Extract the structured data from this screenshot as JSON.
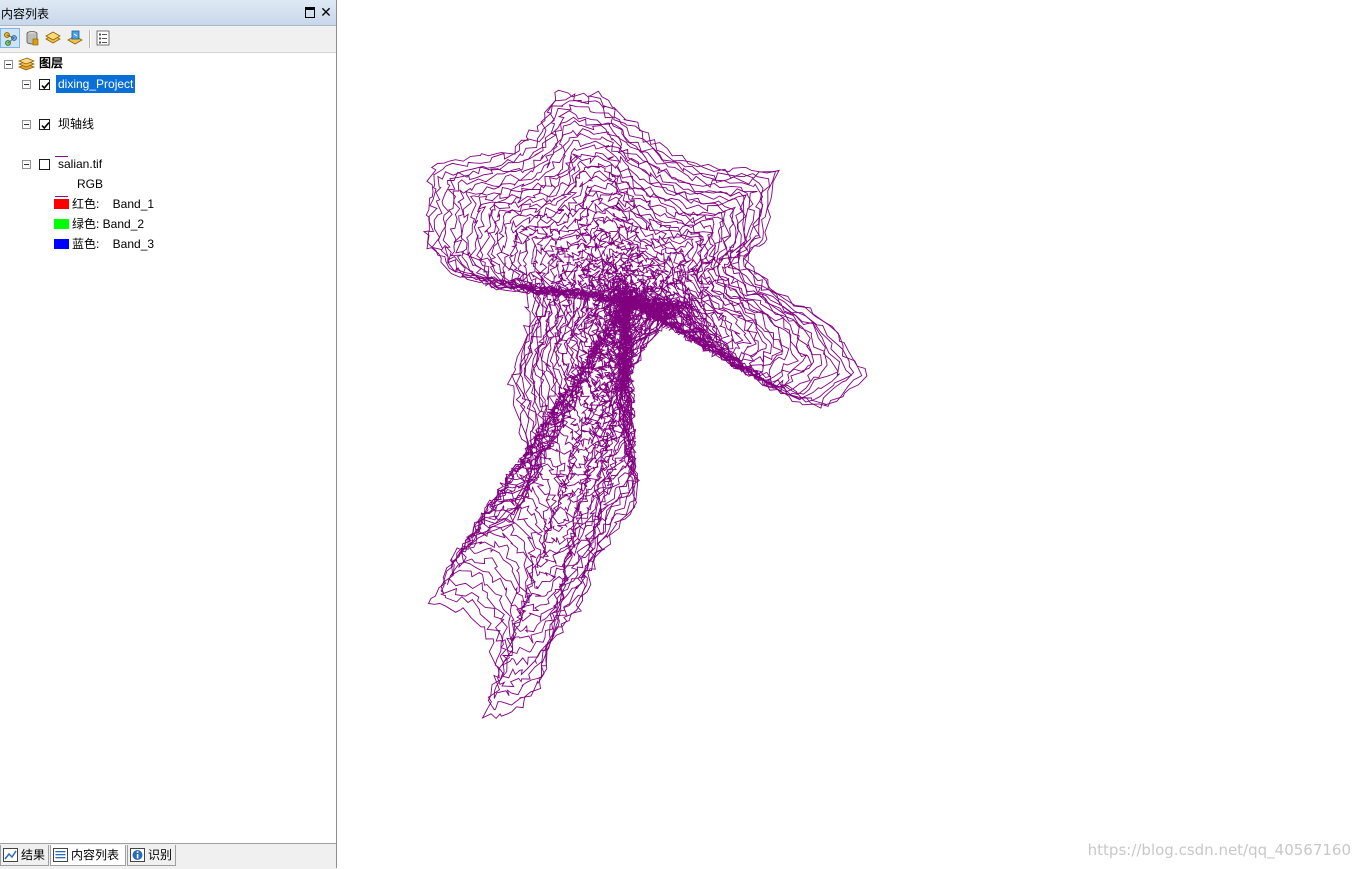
{
  "panel": {
    "title": "内容列表"
  },
  "tree": {
    "root_label": "图层",
    "layers": [
      {
        "label": "dixing_Project",
        "checked": true,
        "selected": true,
        "symbol": "line",
        "color": "#8b0a8b"
      },
      {
        "label": "坝轴线",
        "checked": true,
        "selected": false,
        "symbol": "line",
        "color": "#8b0a8b"
      },
      {
        "label": "salian.tif",
        "checked": false,
        "selected": false,
        "symbol": "raster"
      }
    ],
    "raster": {
      "mode": "RGB",
      "bands": [
        {
          "label": "红色:    Band_1",
          "color": "#ff0000"
        },
        {
          "label": "绿色: Band_2",
          "color": "#00ff00"
        },
        {
          "label": "蓝色:    Band_3",
          "color": "#0000ff"
        }
      ]
    }
  },
  "tabs": [
    {
      "label": "结果",
      "icon": "results-icon"
    },
    {
      "label": "内容列表",
      "icon": "toc-icon",
      "active": true
    },
    {
      "label": "识别",
      "icon": "identify-icon"
    }
  ],
  "map": {
    "contour_color": "#800080",
    "watermark": "https://blog.csdn.net/qq_40567160"
  }
}
